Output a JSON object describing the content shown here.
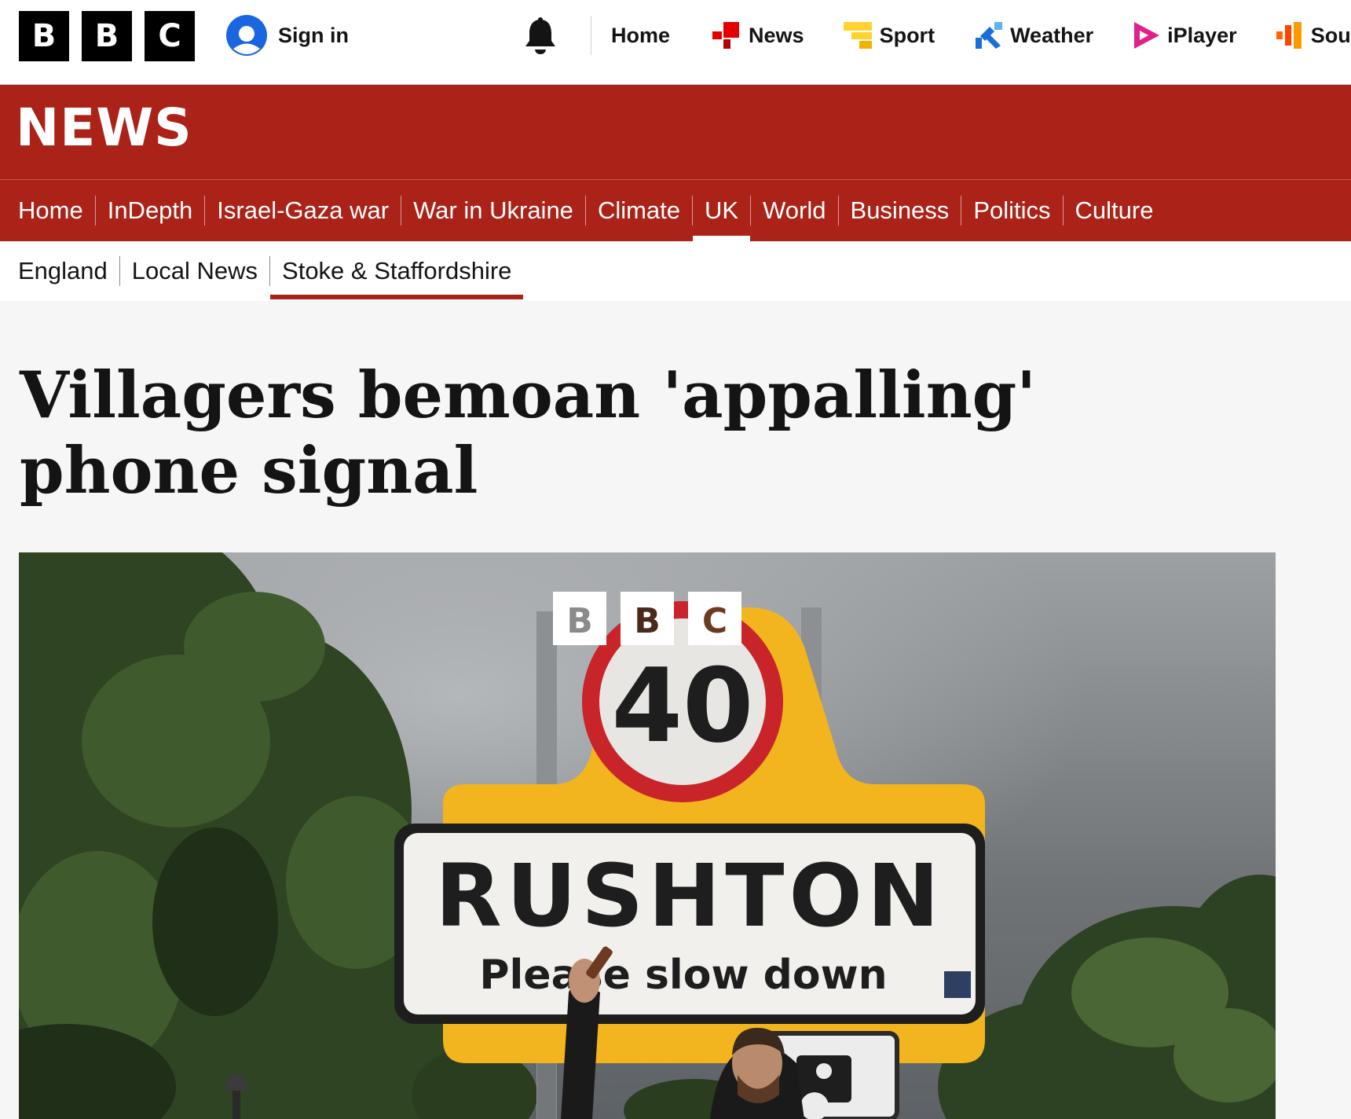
{
  "brand": {
    "letters": [
      "B",
      "B",
      "C"
    ]
  },
  "account": {
    "signin_label": "Sign in"
  },
  "topnav": [
    {
      "label": "Home",
      "icon": ""
    },
    {
      "label": "News",
      "icon": "news-icon",
      "color": "#e50000"
    },
    {
      "label": "Sport",
      "icon": "sport-icon",
      "color": "#ffd230"
    },
    {
      "label": "Weather",
      "icon": "weather-icon",
      "color": "#1a6fd6"
    },
    {
      "label": "iPlayer",
      "icon": "iplayer-icon",
      "color": "#e0218a"
    },
    {
      "label": "Sou",
      "icon": "sounds-icon",
      "color": "#ff6600"
    }
  ],
  "masthead": {
    "title": "NEWS"
  },
  "section_nav": [
    {
      "label": "Home",
      "active": false
    },
    {
      "label": "InDepth",
      "active": false
    },
    {
      "label": "Israel-Gaza war",
      "active": false
    },
    {
      "label": "War in Ukraine",
      "active": false
    },
    {
      "label": "Climate",
      "active": false
    },
    {
      "label": "UK",
      "active": true
    },
    {
      "label": "World",
      "active": false
    },
    {
      "label": "Business",
      "active": false
    },
    {
      "label": "Politics",
      "active": false
    },
    {
      "label": "Culture",
      "active": false
    }
  ],
  "sub_nav": [
    {
      "label": "England",
      "active": false
    },
    {
      "label": "Local News",
      "active": false
    },
    {
      "label": "Stoke & Staffordshire",
      "active": true
    }
  ],
  "article": {
    "headline": "Villagers bemoan 'appalling' phone signal",
    "image": {
      "watermark": [
        "B",
        "B",
        "C"
      ],
      "speed_limit": "40",
      "village_name": "RUSHTON",
      "sign_message": "Please slow down"
    }
  },
  "colors": {
    "news_red": "#ab2218",
    "text": "#141414",
    "background": "#f6f6f6"
  }
}
